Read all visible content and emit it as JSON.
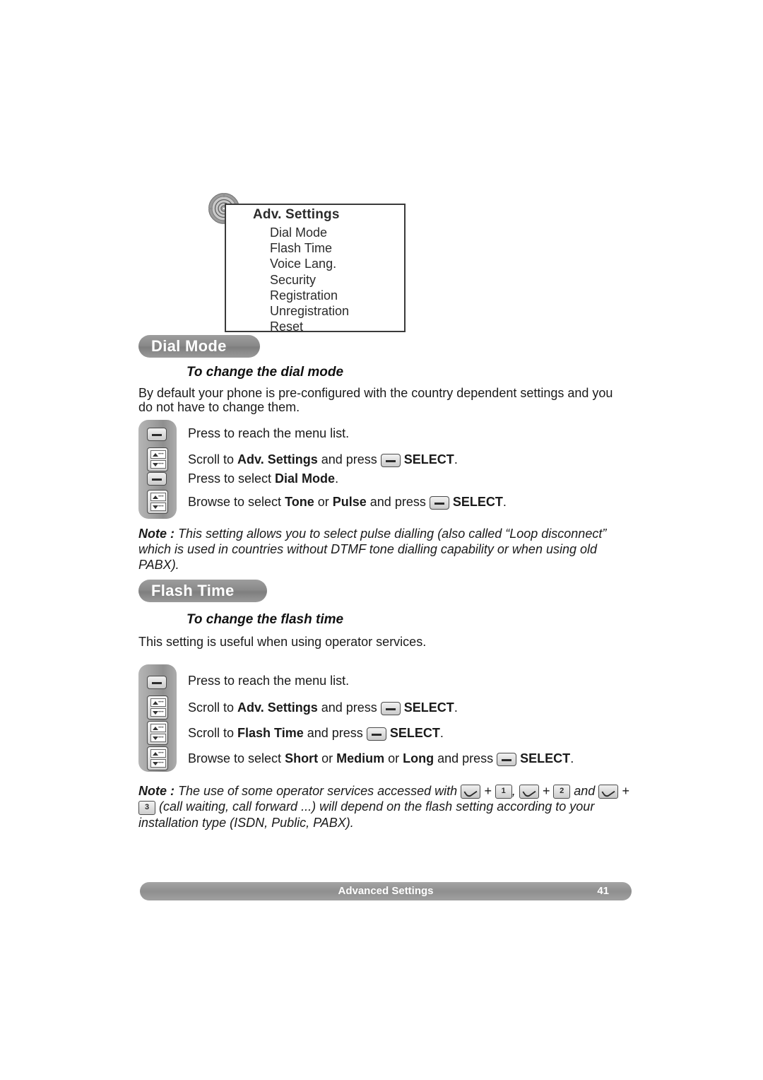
{
  "menu_screen": {
    "title": "Adv. Settings",
    "items": [
      "Dial Mode",
      "Flash Time",
      "Voice Lang.",
      "Security",
      "Registration",
      "Unregistration",
      "Reset"
    ]
  },
  "sections": [
    {
      "banner": "Dial Mode",
      "subhead": "To change the dial mode",
      "intro": "By default your phone is pre-configured with the country dependent settings and you do not have to change them.",
      "steps": [
        {
          "icon": "select-key-icon",
          "text_parts": [
            [
              "Press to reach the menu list.",
              "plain"
            ]
          ]
        },
        {
          "icon": "nav-key-icon",
          "text_parts": [
            [
              "Scroll to ",
              "plain"
            ],
            [
              "Adv. Settings",
              "bold"
            ],
            [
              " and press ",
              "plain"
            ],
            [
              "select-key-icon",
              "key"
            ],
            [
              " ",
              "plain"
            ],
            [
              "SELECT",
              "bold"
            ],
            [
              ".",
              "plain"
            ]
          ]
        },
        {
          "icon": "select-key-icon",
          "text_parts": [
            [
              "Press to select ",
              "plain"
            ],
            [
              "Dial Mode",
              "bold"
            ],
            [
              ".",
              "plain"
            ]
          ]
        },
        {
          "icon": "nav-key-icon",
          "text_parts": [
            [
              "Browse to select ",
              "plain"
            ],
            [
              "Tone",
              "bold"
            ],
            [
              " or ",
              "plain"
            ],
            [
              "Pulse",
              "bold"
            ],
            [
              " and press ",
              "plain"
            ],
            [
              "select-key-icon",
              "key"
            ],
            [
              " ",
              "plain"
            ],
            [
              "SELECT",
              "bold"
            ],
            [
              ".",
              "plain"
            ]
          ]
        }
      ],
      "note_label": "Note :",
      "note": " This setting allows you to select pulse dialling (also called “Loop disconnect” which is used in countries without DTMF tone dialling capability or when using old PABX)."
    },
    {
      "banner": "Flash Time",
      "subhead": "To change the flash time",
      "intro": "This setting is useful when using operator services.",
      "steps": [
        {
          "icon": "select-key-icon",
          "text_parts": [
            [
              "Press to reach the menu list.",
              "plain"
            ]
          ]
        },
        {
          "icon": "nav-key-icon",
          "text_parts": [
            [
              "Scroll to ",
              "plain"
            ],
            [
              "Adv. Settings",
              "bold"
            ],
            [
              " and press ",
              "plain"
            ],
            [
              "select-key-icon",
              "key"
            ],
            [
              " ",
              "plain"
            ],
            [
              "SELECT",
              "bold"
            ],
            [
              ".",
              "plain"
            ]
          ]
        },
        {
          "icon": "nav-key-icon",
          "text_parts": [
            [
              "Scroll to ",
              "plain"
            ],
            [
              "Flash Time",
              "bold"
            ],
            [
              " and press ",
              "plain"
            ],
            [
              "select-key-icon",
              "key"
            ],
            [
              " ",
              "plain"
            ],
            [
              "SELECT",
              "bold"
            ],
            [
              ".",
              "plain"
            ]
          ]
        },
        {
          "icon": "nav-key-icon",
          "text_parts": [
            [
              "Browse to select ",
              "plain"
            ],
            [
              "Short",
              "bold"
            ],
            [
              " or ",
              "plain"
            ],
            [
              "Medium",
              "bold"
            ],
            [
              " or ",
              "plain"
            ],
            [
              "Long",
              "bold"
            ],
            [
              " and press ",
              "plain"
            ],
            [
              "select-key-icon",
              "key"
            ],
            [
              " ",
              "plain"
            ],
            [
              "SELECT",
              "bold"
            ],
            [
              ".",
              "plain"
            ]
          ]
        }
      ],
      "note_label": "Note :",
      "note_a": " The use of some operator services accessed with ",
      "note_plus1": " + ",
      "note_comma": ", ",
      "note_plus2": " + ",
      "note_and": " and ",
      "note_plus3": " + ",
      "note_b": " (call waiting, call forward ...) will depend on the flash setting according to your installation type (ISDN, Public, PABX).",
      "digits": [
        "1",
        "2",
        "3"
      ]
    }
  ],
  "footer": {
    "title": "Advanced Settings",
    "page": "41"
  },
  "colors": {
    "banner_gray": "#8a8a8a",
    "text": "#1a1a1a",
    "screen_border": "#3a3a3a"
  }
}
